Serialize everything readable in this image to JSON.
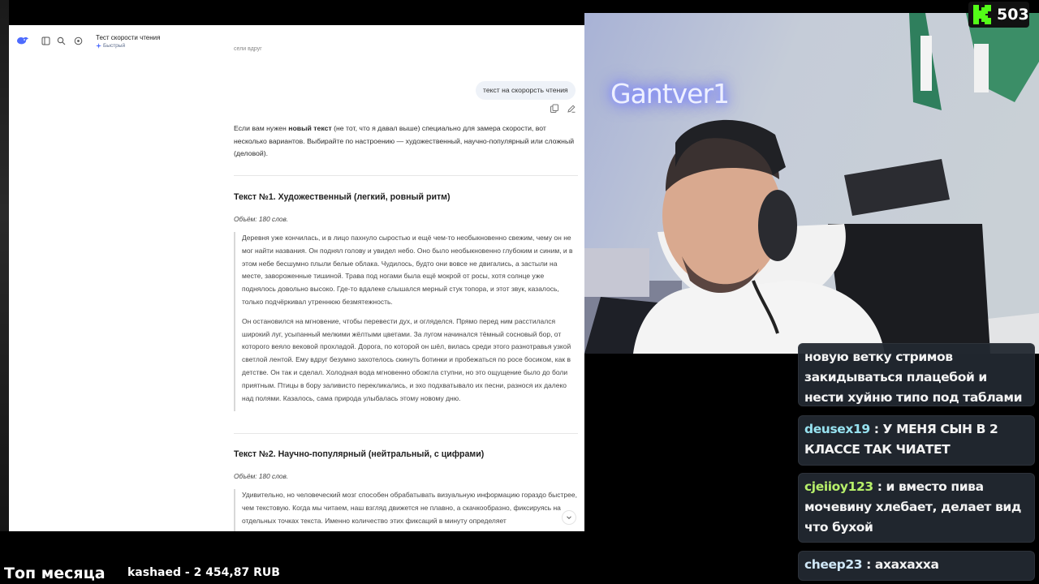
{
  "chat_app": {
    "title": "Тест скорости чтения",
    "mode_label": "Быстрый",
    "top_fragment": "сели вдруг",
    "user_message": "текст на скорорсть чтения",
    "intro_before": "Если вам нужен ",
    "intro_bold": "новый текст",
    "intro_after": " (не тот, что я давал выше) специально для замера скорости, вот несколько вариантов. Выбирайте по настроению — художественный, научно-популярный или сложный (деловой).",
    "sections": [
      {
        "heading": "Текст №1. Художественный (легкий, ровный ритм)",
        "volume": "Объём: 180 слов.",
        "paragraphs": [
          "Деревня уже кончилась, и в лицо пахнуло сыростью и ещё чем-то необыкновенно свежим, чему он не мог найти названия. Он поднял голову и увидел небо. Оно было необыкновенно глубоким и синим, и в этом небе бесшумно плыли белые облака. Чудилось, будто они вовсе не двигались, а застыли на месте, завороженные тишиной. Трава под ногами была ещё мокрой от росы, хотя солнце уже поднялось довольно высоко. Где-то вдалеке слышался мерный стук топора, и этот звук, казалось, только подчёркивал утреннюю безмятежность.",
          "Он остановился на мгновение, чтобы перевести дух, и огляделся. Прямо перед ним расстилался широкий луг, усыпанный мелкими жёлтыми цветами. За лугом начинался тёмный сосновый бор, от которого веяло вековой прохладой. Дорога, по которой он шёл, вилась среди этого разнотравья узкой светлой лентой. Ему вдруг безумно захотелось скинуть ботинки и пробежаться по росе босиком, как в детстве. Он так и сделал. Холодная вода мгновенно обожгла ступни, но это ощущение было до боли приятным. Птицы в бору заливисто перекликались, и эхо подхватывало их песни, разнося их далеко над полями. Казалось, сама природа улыбалась этому новому дню."
        ]
      },
      {
        "heading": "Текст №2. Научно-популярный (нейтральный, с цифрами)",
        "volume": "Объём: 180 слов.",
        "paragraphs": [
          "Удивительно, но человеческий мозг способен обрабатывать визуальную информацию гораздо быстрее, чем текстовую. Когда мы читаем, наш взгляд движется не плавно, а скачкообразно, фиксируясь на отдельных точках текста. Именно количество этих фиксаций в минуту определяет"
        ]
      }
    ]
  },
  "stream": {
    "neon_sign": "Gantver1",
    "viewer_count": "503",
    "chat": [
      {
        "user": "",
        "text": "новую ветку стримов закидываться плацебой и нести хуйню типо под таблами"
      },
      {
        "user": "deusex19",
        "text": "У МЕНЯ СЫН В 2 КЛАССЕ ТАК ЧИАТЕТ"
      },
      {
        "user": "cjeiioy123",
        "text": "и вместо пива мочевину хлебает, делает вид что бухой"
      },
      {
        "user": "cheep23",
        "text": "ахахахха"
      }
    ],
    "top_month_label": "Топ месяца",
    "top_donor": "kashaed - 2 454,87 RUB"
  }
}
